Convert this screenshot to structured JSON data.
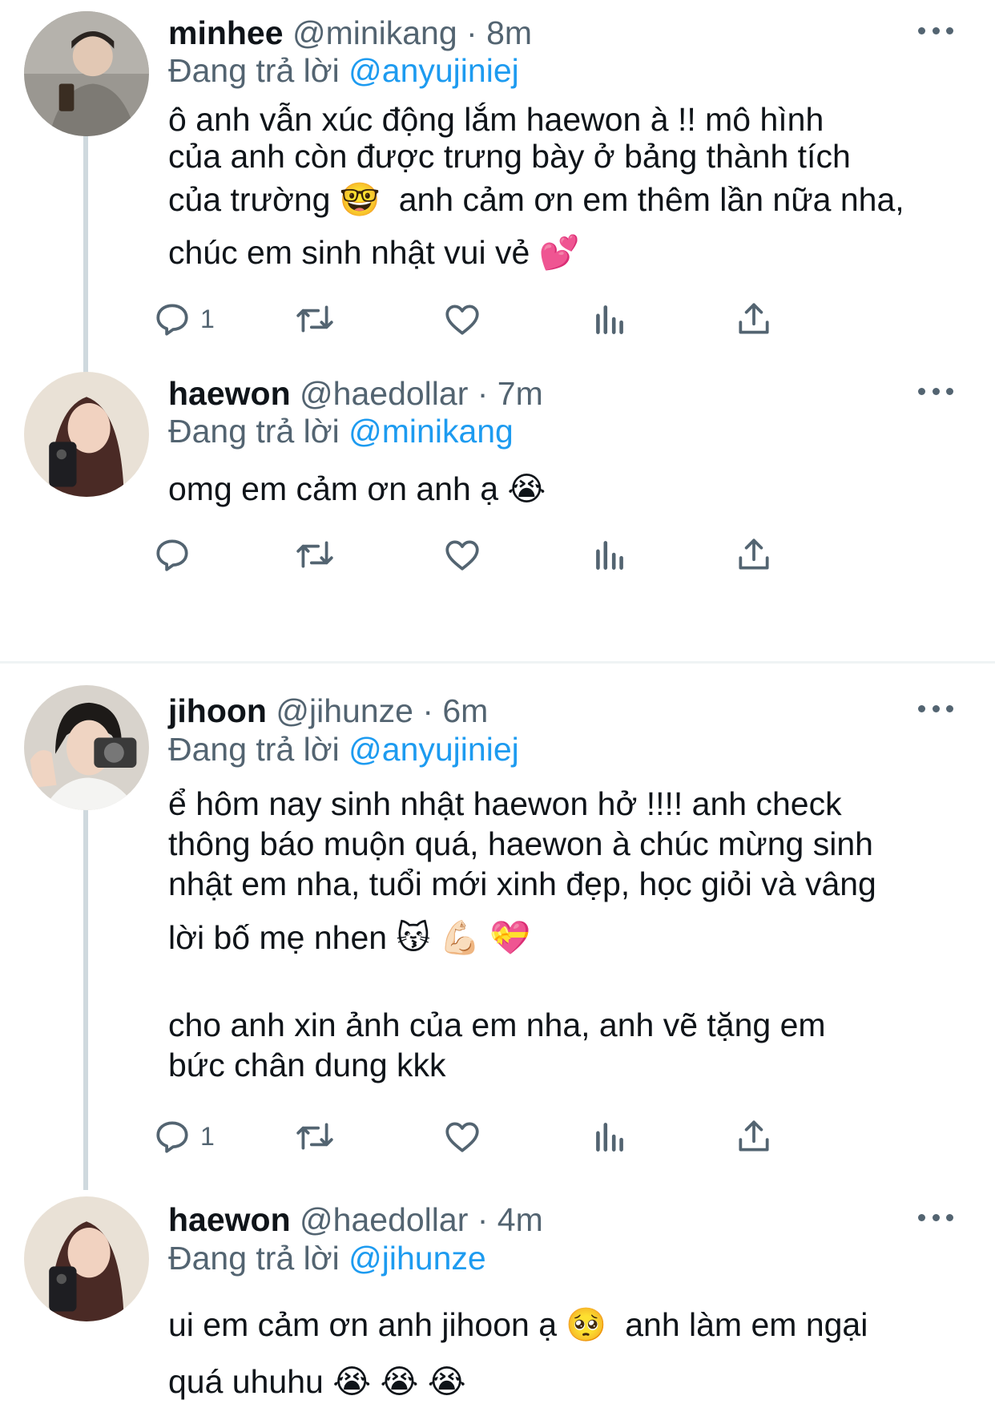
{
  "reply_prefix": "Đang trả lời",
  "tweets": [
    {
      "name": "minhee",
      "meta": "@minikang · 8m",
      "reply_to": "@anyujiniej",
      "lines": [
        "ô anh vẫn xúc động lắm haewon à !! mô hình",
        "của anh còn được trưng bày ở bảng thành tích",
        "của trường 🤓  anh cảm ơn em thêm lần nữa nha,",
        "chúc em sinh nhật vui vẻ 💕"
      ],
      "reply_count": "1"
    },
    {
      "name": "haewon",
      "meta": "@haedollar · 7m",
      "reply_to": "@minikang",
      "lines": [
        "omg em cảm ơn anh ạ 😭"
      ],
      "reply_count": ""
    },
    {
      "name": "jihoon",
      "meta": "@jihunze · 6m",
      "reply_to": "@anyujiniej",
      "lines": [
        "ể hôm nay sinh nhật haewon hở !!!! anh check",
        "thông báo muộn quá, haewon à chúc mừng sinh",
        "nhật em nha, tuổi mới xinh đẹp, học giỏi và vâng",
        "lời bố mẹ nhen 😽 💪🏻 💝",
        "",
        "cho anh xin ảnh của em nha, anh vẽ tặng em",
        "bức chân dung kkk"
      ],
      "reply_count": "1"
    },
    {
      "name": "haewon",
      "meta": "@haedollar · 4m",
      "reply_to": "@jihunze",
      "lines": [
        "ui em cảm ơn anh jihoon ạ 🥺  anh làm em ngại",
        "quá uhuhu 😭 😭 😭"
      ],
      "reply_count": ""
    }
  ],
  "icons": [
    "reply-icon",
    "retweet-icon",
    "like-icon",
    "views-icon",
    "share-icon",
    "more-icon"
  ]
}
